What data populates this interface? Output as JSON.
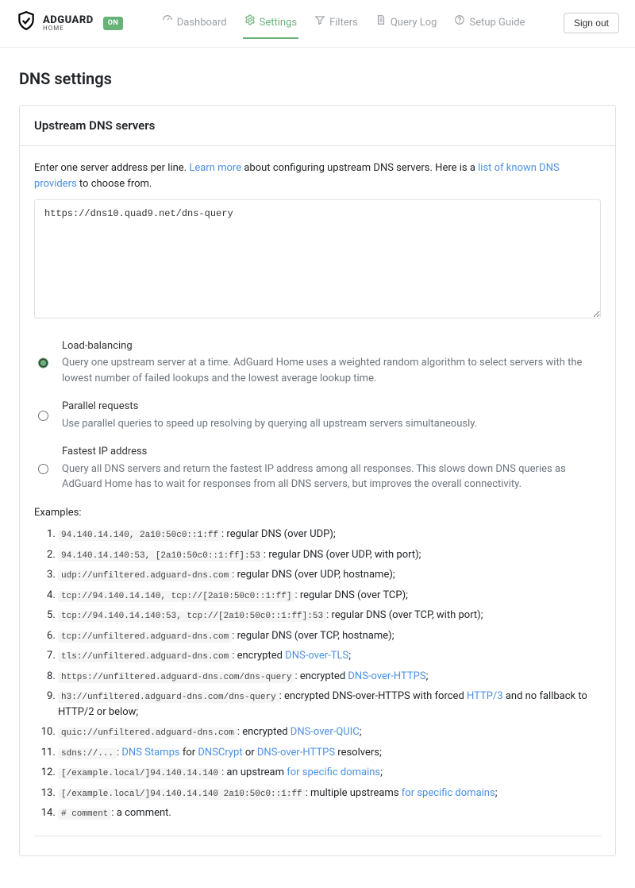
{
  "brand": {
    "name": "ADGUARD",
    "sub": "HOME",
    "status": "ON"
  },
  "nav": {
    "dashboard": "Dashboard",
    "settings": "Settings",
    "filters": "Filters",
    "querylog": "Query Log",
    "setup": "Setup Guide"
  },
  "signout": "Sign out",
  "page_title": "DNS settings",
  "card_title": "Upstream DNS servers",
  "intro1": "Enter one server address per line. ",
  "intro_learn": "Learn more",
  "intro2": " about configuring upstream DNS servers. Here is a ",
  "intro_list": "list of known DNS providers",
  "intro3": " to choose from.",
  "upstreams_value": "https://dns10.quad9.net/dns-query",
  "radios": {
    "lb": {
      "label": "Load-balancing",
      "desc": "Query one upstream server at a time. AdGuard Home uses a weighted random algorithm to select servers with the lowest number of failed lookups and the lowest average lookup time."
    },
    "par": {
      "label": "Parallel requests",
      "desc": "Use parallel queries to speed up resolving by querying all upstream servers simultaneously."
    },
    "fast": {
      "label": "Fastest IP address",
      "desc": "Query all DNS servers and return the fastest IP address among all responses. This slows down DNS queries as AdGuard Home has to wait for responses from all DNS servers, but improves the overall connectivity."
    }
  },
  "examples_label": "Examples:",
  "ex": {
    "e1c": "94.140.14.140, 2a10:50c0::1:ff",
    "e1t": ": regular DNS (over UDP);",
    "e2c": "94.140.14.140:53, [2a10:50c0::1:ff]:53",
    "e2t": ": regular DNS (over UDP, with port);",
    "e3c": "udp://unfiltered.adguard-dns.com",
    "e3t": ": regular DNS (over UDP, hostname);",
    "e4c": "tcp://94.140.14.140, tcp://[2a10:50c0::1:ff]",
    "e4t": ": regular DNS (over TCP);",
    "e5c": "tcp://94.140.14.140:53, tcp://[2a10:50c0::1:ff]:53",
    "e5t": ": regular DNS (over TCP, with port);",
    "e6c": "tcp://unfiltered.adguard-dns.com",
    "e6t": ": regular DNS (over TCP, hostname);",
    "e7c": "tls://unfiltered.adguard-dns.com",
    "e7a": ": encrypted ",
    "e7l": "DNS-over-TLS",
    "e7b": ";",
    "e8c": "https://unfiltered.adguard-dns.com/dns-query",
    "e8a": ": encrypted ",
    "e8l": "DNS-over-HTTPS",
    "e8b": ";",
    "e9c": "h3://unfiltered.adguard-dns.com/dns-query",
    "e9a": ": encrypted DNS-over-HTTPS with forced ",
    "e9l": "HTTP/3",
    "e9b": " and no fallback to HTTP/2 or below;",
    "e10c": "quic://unfiltered.adguard-dns.com",
    "e10a": ": encrypted ",
    "e10l": "DNS-over-QUIC",
    "e10b": ";",
    "e11c": "sdns://...",
    "e11a": ": ",
    "e11l1": "DNS Stamps",
    "e11b": " for ",
    "e11l2": "DNSCrypt",
    "e11cc": " or ",
    "e11l3": "DNS-over-HTTPS",
    "e11d": " resolvers;",
    "e12c": "[/example.local/]94.140.14.140",
    "e12a": ": an upstream ",
    "e12l": "for specific domains",
    "e12b": ";",
    "e13c": "[/example.local/]94.140.14.140 2a10:50c0::1:ff",
    "e13a": ": multiple upstreams ",
    "e13l": "for specific domains",
    "e13b": ";",
    "e14c": "# comment",
    "e14t": ": a comment."
  }
}
